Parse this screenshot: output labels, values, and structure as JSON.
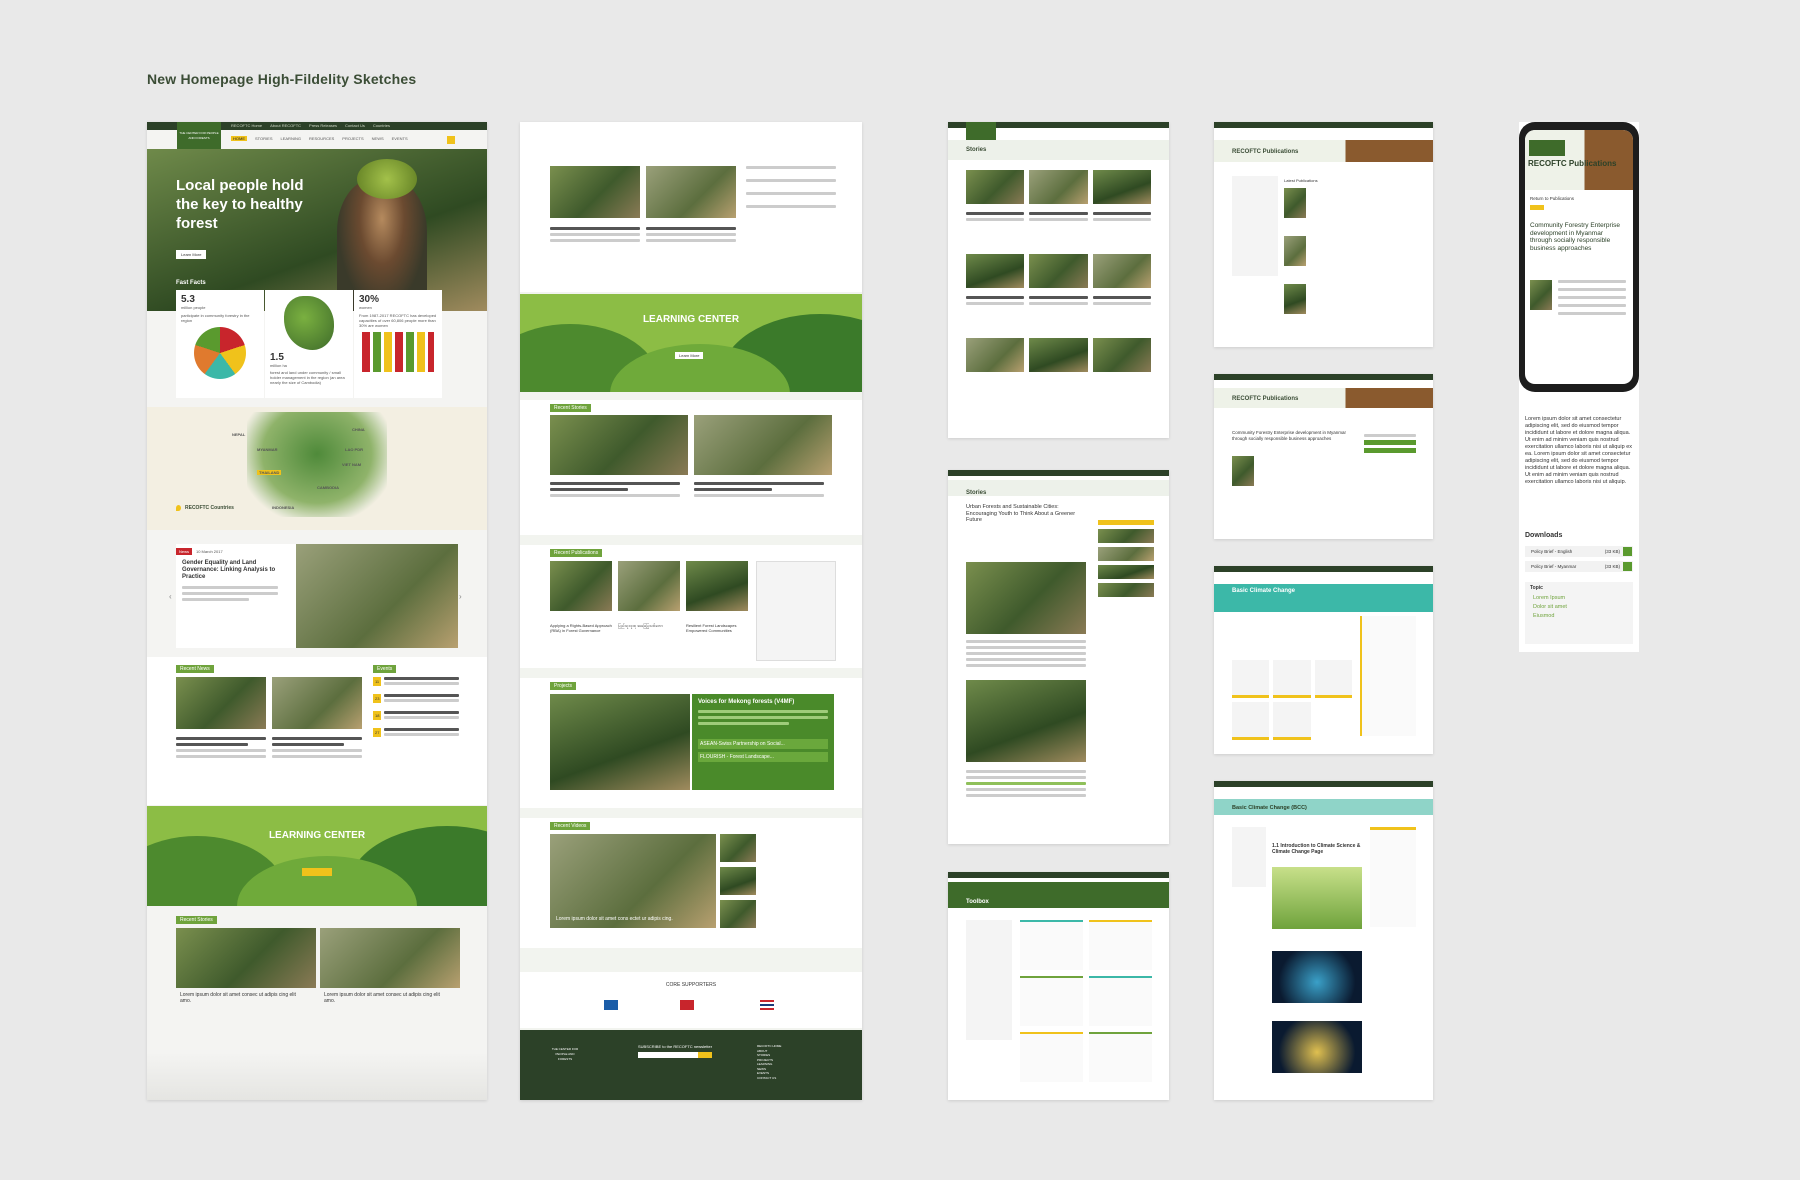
{
  "title": "New Homepage High-Fildelity Sketches",
  "colors": {
    "forest": "#2c4128",
    "leaf": "#6fa33c",
    "accent": "#f0c21b",
    "red": "#c8252c",
    "teal": "#3cb8a8"
  },
  "home": {
    "logo": "THE CENTER FOR PEOPLE AND FORESTS",
    "nav_top": [
      "RECOFTC Home",
      "About RECOFTC",
      "Press Releases",
      "Contact Us",
      "Countries"
    ],
    "nav_main": [
      "HOME",
      "STORIES",
      "LEARNING",
      "RESOURCES",
      "PROJECTS",
      "NEWS",
      "EVENTS"
    ],
    "hero": {
      "l1": "Local people hold",
      "l2": "the key to healthy",
      "l3": "forest",
      "btn": "Learn More"
    },
    "facts_title": "Fast Facts",
    "facts": [
      {
        "num": "5.3",
        "unit": "million people",
        "desc": "participate in community forestry in the region"
      },
      {
        "num": "1.5",
        "unit": "million ha",
        "desc": "forest and land under community / small holder management in the region (an area nearly the size of Cambodia)"
      },
      {
        "num": "30%",
        "unit": "women",
        "desc": "From 1987-2017 RECOFTC has developed capacities of over 60,806 people more than 30% are women"
      }
    ],
    "map_labels": [
      "NEPAL",
      "MYANMAR",
      "THAILAND",
      "LAO PDR",
      "CHINA",
      "VIET NAM",
      "CAMBODIA",
      "INDONESIA"
    ],
    "countries": "RECOFTC Countries",
    "story": {
      "tag": "News",
      "date": "10 March 2017",
      "title": "Gender Equality and Land Governance: Linking Analysis to Practice"
    },
    "recent_news": "Recent News",
    "events": "Events",
    "event_dates": [
      "11",
      "23",
      "18",
      "27"
    ],
    "learning": "LEARNING CENTER",
    "recent_stories": "Recent Stories",
    "story_card": "Lorem ipsum dolor sit amet consec ut adipis cing elit amo."
  },
  "col2": {
    "learning": "LEARNING CENTER",
    "learn_btn": "Learn More",
    "recent_stories": "Recent Stories",
    "recent_pubs": "Recent Publications",
    "pub_titles": [
      "Applying a Rights-Based Approach (RBA) in Forest Governance",
      "ပြည်သူလူထု အခြေပြုသစ်တော",
      "Resilient Forest Landscapes Empowered Communities"
    ],
    "projects": "Projects",
    "proj_title": "Voices for Mekong forests (V4MF)",
    "proj_items": [
      "ASEAN-Swiss Partnership on Social...",
      "FLOURISH - Forest Landscape..."
    ],
    "recent_videos": "Recent Videos",
    "video_caption": "Lorem ipsum dolor sit amet cons ectet ur adipis cing.",
    "core_supporters": "CORE SUPPORTERS",
    "subscribe": "SUBSCRIBE to the RECOFTC newsletter",
    "footer_links": [
      "RECOFTC HOME",
      "ABOUT",
      "STORIES",
      "PROJECTS",
      "LEARNING",
      "NEWS",
      "EVENTS",
      "CONTACT US"
    ]
  },
  "col3": {
    "stories": "Stories",
    "article_title": "Urban Forests and Sustainable Cities: Encouraging Youth to Think About a Greener Future",
    "toolbox": "Toolbox"
  },
  "col4": {
    "pubs": "RECOFTC Publications",
    "latest": "Latest Publications",
    "pub_detail": "Community Forestry Enterprise development in Myanmar through socially responsible business approaches",
    "bcc": "Basic Climate Change",
    "bcc2": "Basic Climate Change (BCC)",
    "bcc_lesson": "1.1 Introduction to Climate Science & Climate Change Page"
  },
  "mobile": {
    "title": "RECOFTC Publications",
    "return": "Return to Publications",
    "pub_title": "Community Forestry Enterprise development in Myanmar through socially responsible business approaches",
    "body": "Lorem ipsum dolor sit amet consectetur adipiscing elit, sed do eiusmod tempor incididunt ut labore et dolore magna aliqua. Ut enim ad minim veniam quis nostrud exercitation ullamco laboris nisi ut aliquip ex ea. Lorem ipsum dolor sit amet consectetur adipiscing elit, sed do eiusmod tempor incididunt ut labore et dolore magna aliqua. Ut enim ad minim veniam quis nostrud exercitation ullamco laboris nisi ut aliquip.",
    "downloads": "Downloads",
    "dl": [
      "Policy Brief - English",
      "Policy Brief - Myanmar"
    ],
    "dl_size": "(33 KB)",
    "topic": "Topic",
    "topics": [
      "Lorem Ipsum",
      "Dolor sit amet",
      "Eiusmod"
    ]
  }
}
